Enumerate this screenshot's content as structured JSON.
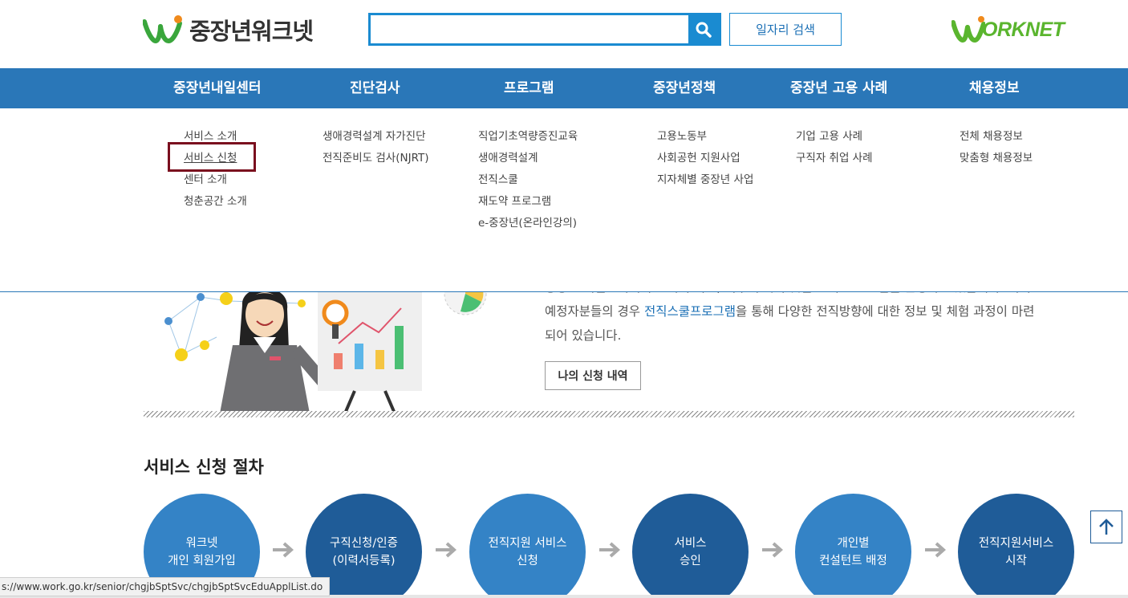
{
  "header": {
    "site_title": "중장년워크넷",
    "search": {
      "value": "",
      "placeholder": ""
    },
    "job_search_label": "일자리 검색",
    "partner_logo_text": "ORKNET"
  },
  "nav": {
    "items": [
      {
        "label": "중장년내일센터"
      },
      {
        "label": "진단검사"
      },
      {
        "label": "프로그램"
      },
      {
        "label": "중장년정책"
      },
      {
        "label": "중장년 고용 사례"
      },
      {
        "label": "채용정보"
      }
    ]
  },
  "dropdown": {
    "columns": [
      {
        "links": [
          "서비스 소개",
          "서비스 신청",
          "센터 소개",
          "청춘공간 소개"
        ]
      },
      {
        "links": [
          "생애경력설계 자가진단",
          "전직준비도 검사(NJRT)"
        ]
      },
      {
        "links": [
          "직업기초역량증진교육",
          "생애경력설계",
          "전직스쿨",
          "재도약 프로그램",
          "e-중장년(온라인강의)"
        ]
      },
      {
        "links": [
          "고용노동부",
          "사회공헌 지원사업",
          "지자체별 중장년 사업"
        ]
      },
      {
        "links": [
          "기업 고용 사례",
          "구직자 취업 사례"
        ]
      },
      {
        "links": [
          "전체 채용정보",
          "맞춤형 채용정보"
        ]
      }
    ],
    "selected": "서비스 신청"
  },
  "intro": {
    "line1_partial": "중장년 내일센터에서는 퇴직 이전, 이후에 따라 맞춤 교육 프로그램을 운영하고 있습니다. 퇴직",
    "line2_pre": "예정자분들의 경우 ",
    "line2_link": "전직스쿨프로그램",
    "line2_post": "을 통해 다양한 전직방향에 대한 정보 및 체험 과정이 마련",
    "line3": "되어 있습니다.",
    "my_apply_label": "나의 신청 내역"
  },
  "process": {
    "title": "서비스 신청 절차",
    "steps": [
      {
        "line1": "워크넷",
        "line2": "개인 회원가입"
      },
      {
        "line1": "구직신청/인증",
        "line2": "(이력서등록)"
      },
      {
        "line1": "전직지원 서비스",
        "line2": "신청"
      },
      {
        "line1": "서비스",
        "line2": "승인"
      },
      {
        "line1": "개인별",
        "line2": "컨설턴트 배정"
      },
      {
        "line1": "전직지원서비스",
        "line2": "시작"
      }
    ]
  },
  "status_url": "s://www.work.go.kr/senior/chgjbSptSvc/chgjbSptSvcEduApplList.do",
  "colors": {
    "nav_bg": "#2a77b8",
    "accent": "#1a8bd1",
    "step_light": "#3483c6",
    "step_dark": "#1f5c98",
    "highlight_border": "#7a0f1e",
    "worknet_green": "#5ab52e"
  },
  "icons": [
    "search-icon",
    "arrow-up-icon",
    "arrow-right-icon"
  ]
}
